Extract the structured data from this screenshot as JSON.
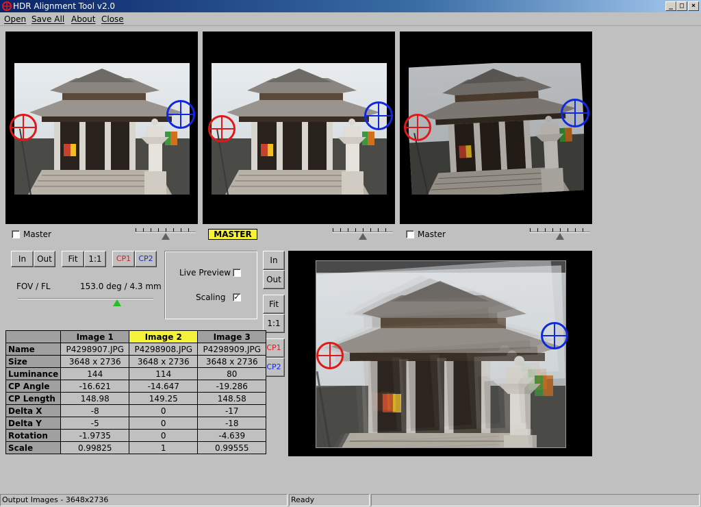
{
  "window": {
    "title": "HDR Alignment Tool  v2.0",
    "minimize_glyph": "_",
    "maximize_glyph": "□",
    "close_glyph": "×"
  },
  "menu": [
    "Open",
    "Save All",
    "About",
    "Close"
  ],
  "images": [
    {
      "master_label": "Master",
      "is_master": false,
      "slider_value": 0.5
    },
    {
      "master_label": "MASTER",
      "is_master": true,
      "slider_value": 0.5
    },
    {
      "master_label": "Master",
      "is_master": false,
      "slider_value": 0.5
    }
  ],
  "zoom": {
    "in": "In",
    "out": "Out",
    "fit": "Fit",
    "one_to_one": "1:1",
    "cp1": "CP1",
    "cp2": "CP2"
  },
  "fov": {
    "label": "FOV / FL",
    "value": "153.0 deg / 4.3 mm",
    "slider_value": 0.73
  },
  "options": {
    "live_preview_label": "Live Preview",
    "live_preview_checked": false,
    "scaling_label": "Scaling",
    "scaling_checked": true
  },
  "preview_controls": {
    "in": "In",
    "out": "Out",
    "fit": "Fit",
    "one_to_one": "1:1",
    "cp1": "CP1",
    "cp2": "CP2"
  },
  "table": {
    "headers": [
      "",
      "Image 1",
      "Image 2",
      "Image 3"
    ],
    "selected_column": 2,
    "rows": [
      {
        "label": "Name",
        "values": [
          "P4298907.JPG",
          "P4298908.JPG",
          "P4298909.JPG"
        ]
      },
      {
        "label": "Size",
        "values": [
          "3648 x 2736",
          "3648 x 2736",
          "3648 x 2736"
        ]
      },
      {
        "label": "Luminance",
        "values": [
          "144",
          "114",
          "80"
        ]
      },
      {
        "label": "CP Angle",
        "values": [
          "-16.621",
          "-14.647",
          "-19.286"
        ]
      },
      {
        "label": "CP Length",
        "values": [
          "148.98",
          "149.25",
          "148.58"
        ]
      },
      {
        "label": "Delta X",
        "values": [
          "-8",
          "0",
          "-17"
        ]
      },
      {
        "label": "Delta Y",
        "values": [
          "-5",
          "0",
          "-18"
        ]
      },
      {
        "label": "Rotation",
        "values": [
          "-1.9735",
          "0",
          "-4.639"
        ]
      },
      {
        "label": "Scale",
        "values": [
          "0.99825",
          "1",
          "0.99555"
        ]
      }
    ]
  },
  "status": {
    "output": "Output Images - 3648x2736",
    "state": "Ready",
    "extra": ""
  },
  "colors": {
    "master_highlight": "#f5f23a",
    "cp1": "#e01818",
    "cp2": "#1028e0",
    "fov_thumb": "#22c022"
  }
}
